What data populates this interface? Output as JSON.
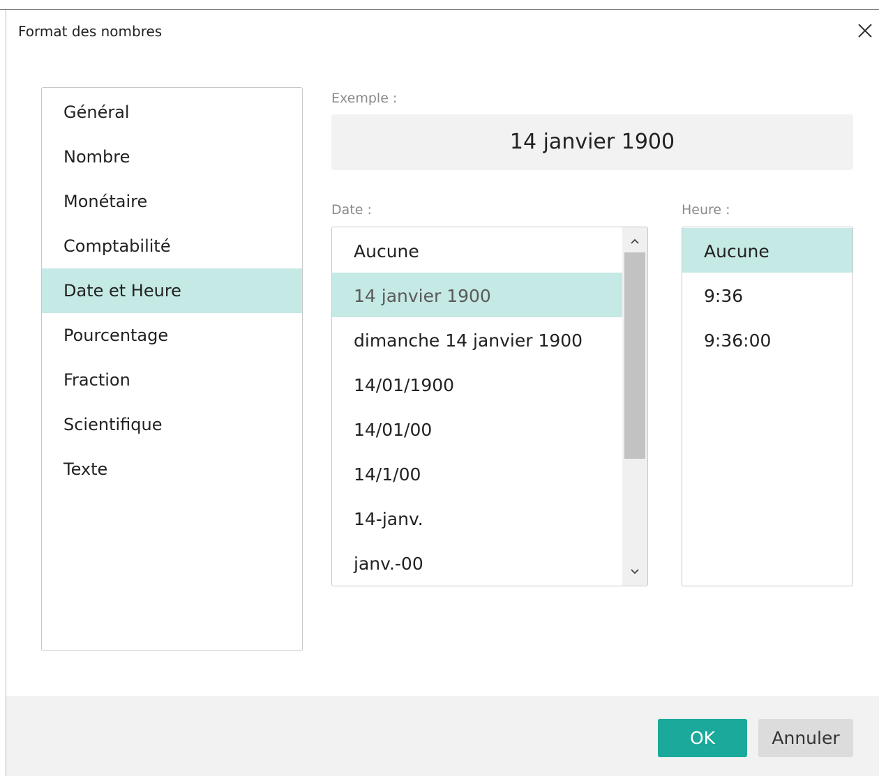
{
  "dialog": {
    "title": "Format des nombres"
  },
  "categories": [
    {
      "label": "Général",
      "selected": false
    },
    {
      "label": "Nombre",
      "selected": false
    },
    {
      "label": "Monétaire",
      "selected": false
    },
    {
      "label": "Comptabilité",
      "selected": false
    },
    {
      "label": "Date et Heure",
      "selected": true
    },
    {
      "label": "Pourcentage",
      "selected": false
    },
    {
      "label": "Fraction",
      "selected": false
    },
    {
      "label": "Scientifique",
      "selected": false
    },
    {
      "label": "Texte",
      "selected": false
    }
  ],
  "example": {
    "label": "Exemple :",
    "value": "14 janvier 1900"
  },
  "date": {
    "label": "Date :",
    "items": [
      {
        "label": "Aucune",
        "selected": false
      },
      {
        "label": "14 janvier 1900",
        "selected": true
      },
      {
        "label": "dimanche 14 janvier 1900",
        "selected": false
      },
      {
        "label": "14/01/1900",
        "selected": false
      },
      {
        "label": "14/01/00",
        "selected": false
      },
      {
        "label": "14/1/00",
        "selected": false
      },
      {
        "label": "14-janv.",
        "selected": false
      },
      {
        "label": "janv.-00",
        "selected": false
      }
    ]
  },
  "time": {
    "label": "Heure :",
    "items": [
      {
        "label": "Aucune",
        "selected": true
      },
      {
        "label": "9:36",
        "selected": false
      },
      {
        "label": "9:36:00",
        "selected": false
      }
    ]
  },
  "buttons": {
    "ok_label": "OK",
    "cancel_label": "Annuler"
  },
  "colors": {
    "selection": "#c5e9e4",
    "accent": "#1aa99b"
  },
  "icons": {
    "close": "close-icon",
    "scroll_up": "chevron-up-icon",
    "scroll_down": "chevron-down-icon"
  }
}
